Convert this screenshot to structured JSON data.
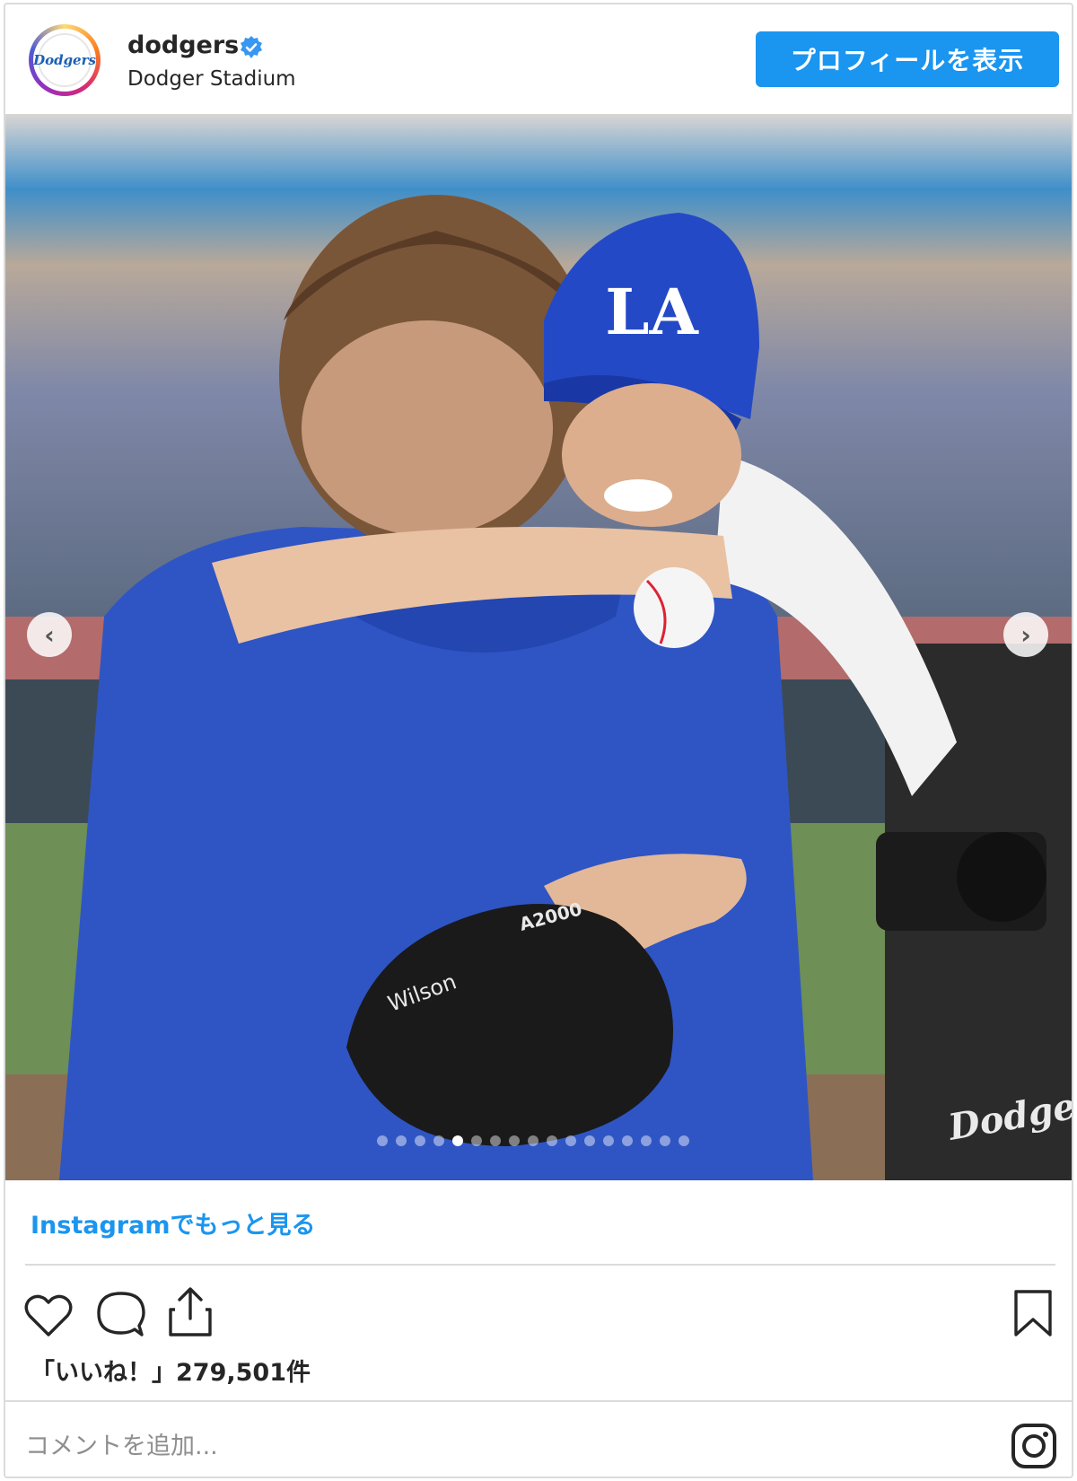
{
  "header": {
    "username": "dodgers",
    "location": "Dodger Stadium",
    "profile_button": "プロフィールを表示",
    "avatar_text": "Dodgers"
  },
  "post": {
    "watermark": "Dodgers",
    "carousel": {
      "slide_count": 17,
      "active_index": 4
    }
  },
  "footer": {
    "see_more": "Instagramでもっと見る",
    "likes_text": "「いいね！」279,501件",
    "comment_placeholder": "コメントを追加..."
  },
  "colors": {
    "accent": "#1a95f0",
    "text": "#262626",
    "border": "#dbdbdb",
    "verified": "#3897f0"
  },
  "icons": [
    "verified-badge-icon",
    "chevron-left-icon",
    "chevron-right-icon",
    "heart-icon",
    "comment-icon",
    "share-icon",
    "bookmark-icon",
    "instagram-logo-icon"
  ]
}
